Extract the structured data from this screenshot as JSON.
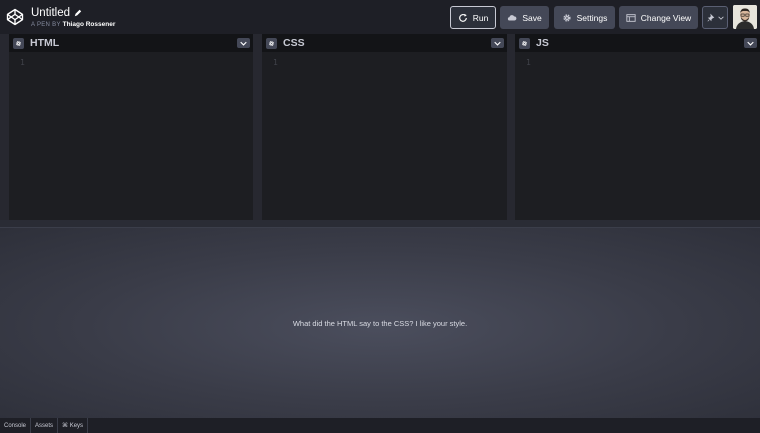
{
  "header": {
    "title": "Untitled",
    "byline_prefix": "A PEN BY",
    "author": "Thiago Rossener",
    "buttons": {
      "run": "Run",
      "save": "Save",
      "settings": "Settings",
      "change_view": "Change View"
    },
    "icons": [
      "codepen-logo-icon",
      "pencil-icon",
      "refresh-icon",
      "cloud-icon",
      "gear-icon",
      "layout-icon",
      "pin-icon",
      "chevron-down-icon"
    ]
  },
  "editors": [
    {
      "lang": "HTML",
      "line": "1"
    },
    {
      "lang": "CSS",
      "line": "1"
    },
    {
      "lang": "JS",
      "line": "1"
    }
  ],
  "preview": {
    "text": "What did the HTML say to the CSS? I like your style."
  },
  "footer": {
    "tabs": [
      "Console",
      "Assets",
      "⌘ Keys"
    ]
  },
  "colors": {
    "background": "#131417",
    "header": "#1e1f26",
    "button": "#444857",
    "editor": "#1d1e22"
  }
}
